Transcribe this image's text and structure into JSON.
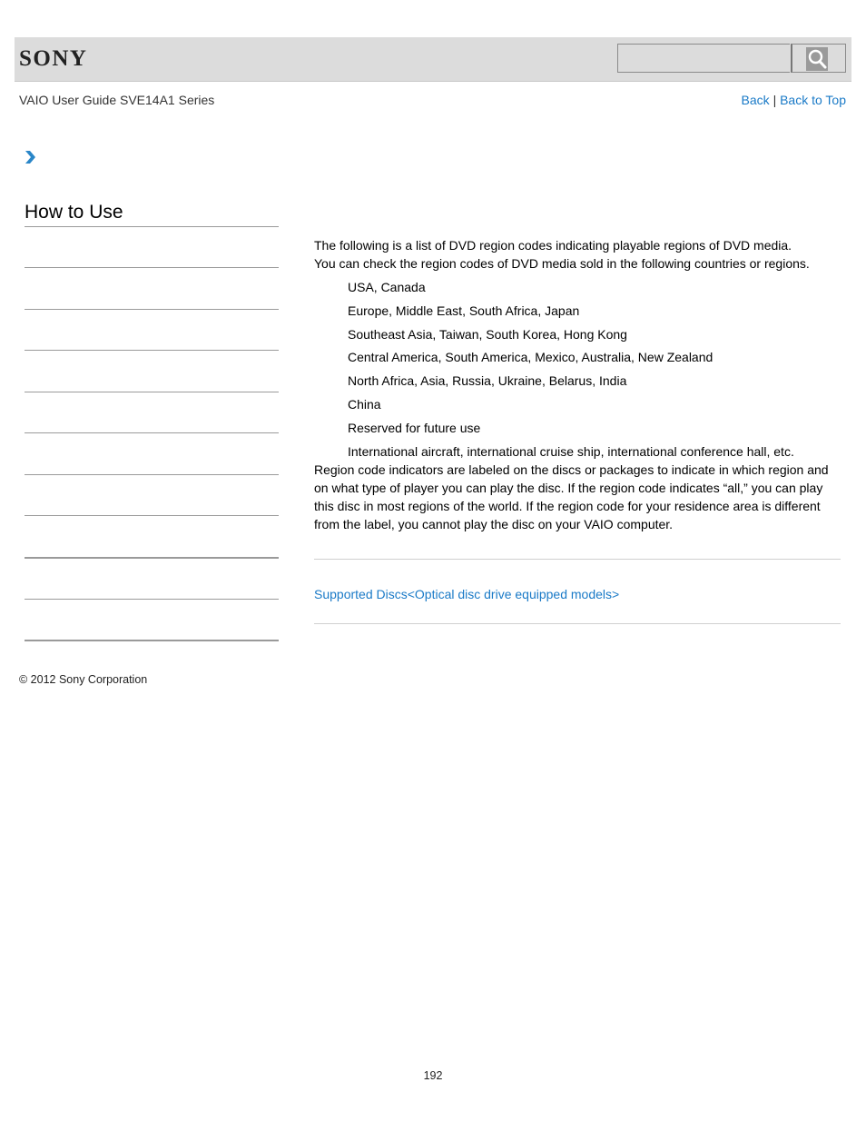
{
  "header": {
    "logo": "SONY",
    "search": {
      "placeholder": "",
      "value": ""
    },
    "search_button_icon": "search-icon"
  },
  "nav": {
    "guide_title": "VAIO User Guide SVE14A1 Series",
    "back_label": "Back",
    "separator": "|",
    "back_to_top_label": "Back to Top",
    "breadcrumb_icon": "chevron-right-icon"
  },
  "sidebar": {
    "title": "How to Use",
    "items": [
      {
        "label": ""
      },
      {
        "label": ""
      },
      {
        "label": ""
      },
      {
        "label": ""
      },
      {
        "label": ""
      },
      {
        "label": ""
      },
      {
        "label": ""
      },
      {
        "label": ""
      },
      {
        "label": ""
      },
      {
        "label": ""
      }
    ]
  },
  "main": {
    "intro_1": "The following is a list of DVD region codes indicating playable regions of DVD media.",
    "intro_2": "You can check the region codes of DVD media sold in the following countries or regions.",
    "regions": [
      "USA, Canada",
      "Europe, Middle East, South Africa, Japan",
      "Southeast Asia, Taiwan, South Korea, Hong Kong",
      "Central America, South America, Mexico, Australia, New Zealand",
      "North Africa, Asia, Russia, Ukraine, Belarus, India",
      "China",
      "Reserved for future use",
      "International aircraft, international cruise ship, international conference hall, etc."
    ],
    "note": "Region code indicators are labeled on the discs or packages to indicate in which region and on what type of player you can play the disc. If the region code indicates “all,” you can play this disc in most regions of the world. If the region code for your residence area is different from the label, you cannot play the disc on your VAIO computer.",
    "related_link": "Supported Discs<Optical disc drive equipped models>"
  },
  "footer": {
    "copyright": "© 2012 Sony Corporation",
    "page_number": "192"
  },
  "colors": {
    "link": "#1a7ac7",
    "header_bg": "#dcdcdc",
    "chevron": "#2a86c8"
  }
}
